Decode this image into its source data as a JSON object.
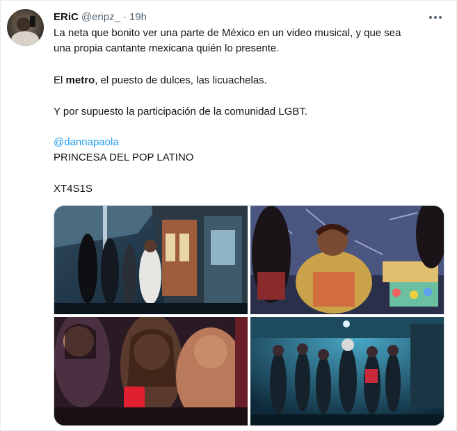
{
  "tweet": {
    "display_name": "ERiC",
    "handle": "@eripz_",
    "separator": "·",
    "time": "19h",
    "more_icon": "more-horizontal-icon",
    "line1": "La neta que bonito ver una parte de México en un video musical, y que sea",
    "line2": "una propia cantante mexicana quién lo presente.",
    "line3_prefix": "El ",
    "line3_bold": "metro",
    "line3_suffix": ", el puesto de dulces, las licuachelas.",
    "line4": "Y por supuesto la participación de la comunidad LGBT.",
    "mention": "@dannapaola",
    "line5": "PRINCESA DEL POP LATINO",
    "line6": "XT4S1S"
  },
  "media": {
    "tiles": [
      {
        "label": "metro-platform-photo"
      },
      {
        "label": "candy-stand-photo"
      },
      {
        "label": "party-crowd-photo"
      },
      {
        "label": "dancers-group-photo"
      }
    ]
  },
  "colors": {
    "text": "#0f1419",
    "muted": "#536471",
    "link": "#1d9bf0",
    "border": "#cfd9de"
  }
}
